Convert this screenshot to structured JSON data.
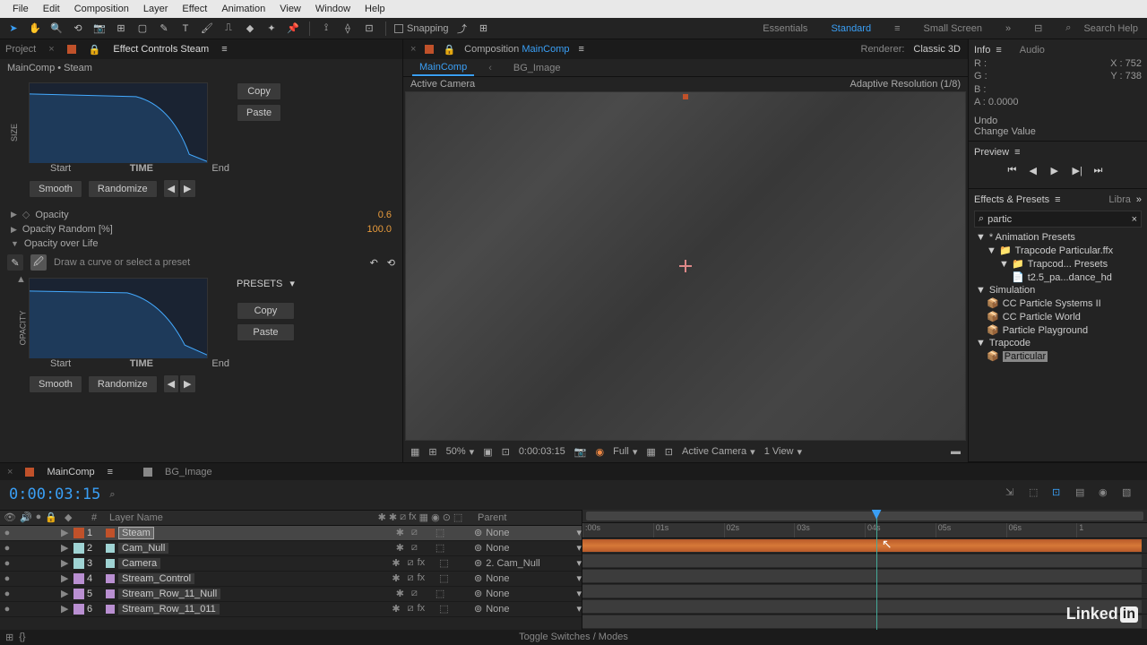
{
  "menu": [
    "File",
    "Edit",
    "Composition",
    "Layer",
    "Effect",
    "Animation",
    "View",
    "Window",
    "Help"
  ],
  "toolbar": {
    "snapping": "Snapping",
    "workspaces": [
      "Essentials",
      "Standard",
      "Small Screen"
    ],
    "active_workspace": "Standard",
    "search_placeholder": "Search Help"
  },
  "left": {
    "tabs": {
      "project": "Project",
      "fx": "Effect Controls",
      "fx_target": "Steam"
    },
    "breadcrumb": "MainComp • Steam",
    "graph1": {
      "ylabel": "SIZE",
      "start": "Start",
      "time": "TIME",
      "end": "End"
    },
    "smooth": "Smooth",
    "randomize": "Randomize",
    "copy": "Copy",
    "paste": "Paste",
    "opacity": {
      "label": "Opacity",
      "value": "0.6"
    },
    "opacity_rand": {
      "label": "Opacity Random [%]",
      "value": "100.0"
    },
    "opacity_life": "Opacity over Life",
    "curve_hint": "Draw a curve or select a preset",
    "presets": "PRESETS",
    "graph2": {
      "ylabel": "OPACITY",
      "start": "Start",
      "time": "TIME",
      "end": "End"
    }
  },
  "center": {
    "tabs": {
      "composition": "Composition",
      "comp_name": "MainComp"
    },
    "subtabs": [
      "MainComp",
      "BG_Image"
    ],
    "renderer_label": "Renderer:",
    "renderer": "Classic 3D",
    "camera": "Active Camera",
    "resolution": "Adaptive Resolution (1/8)",
    "footer": {
      "zoom": "50%",
      "timecode": "0:00:03:15",
      "quality": "Full",
      "view": "Active Camera",
      "views": "1 View"
    }
  },
  "right": {
    "info": "Info",
    "audio": "Audio",
    "rgb": {
      "r": "R :",
      "g": "G :",
      "b": "B :",
      "a": "A :  0.0000"
    },
    "xy": {
      "x": "X : 752",
      "y": "Y : 738"
    },
    "undo": "Undo",
    "change": "Change Value",
    "preview": "Preview",
    "ep": "Effects & Presets",
    "libr": "Libra",
    "search_val": "partic",
    "tree": {
      "anim": "* Animation Presets",
      "trap_ffx": "Trapcode Particular.ffx",
      "trap_pre": "Trapcod... Presets",
      "preset1": "t2.5_pa...dance_hd",
      "sim": "Simulation",
      "cc_sys": "CC Particle Systems II",
      "cc_world": "CC Particle World",
      "pp": "Particle Playground",
      "trap": "Trapcode",
      "particular": "Particular"
    }
  },
  "timeline": {
    "tabs": [
      "MainComp",
      "BG_Image"
    ],
    "timecode": "0:00:03:15",
    "cols": {
      "num": "#",
      "layer": "Layer Name",
      "parent": "Parent"
    },
    "ticks": [
      ":00s",
      "01s",
      "02s",
      "03s",
      "04s",
      "05s",
      "06s",
      "1"
    ],
    "layers": [
      {
        "num": "1",
        "color": "#c0512a",
        "name": "Steam",
        "parent": "None",
        "sel": true
      },
      {
        "num": "2",
        "color": "#9fd3d3",
        "name": "Cam_Null",
        "parent": "None",
        "sel": false
      },
      {
        "num": "3",
        "color": "#9fd3d3",
        "name": "Camera",
        "parent": "2. Cam_Null",
        "sel": false
      },
      {
        "num": "4",
        "color": "#b98fd1",
        "name": "Stream_Control",
        "parent": "None",
        "sel": false
      },
      {
        "num": "5",
        "color": "#b98fd1",
        "name": "Stream_Row_11_Null",
        "parent": "None",
        "sel": false
      },
      {
        "num": "6",
        "color": "#b98fd1",
        "name": "Stream_Row_11_011",
        "parent": "None",
        "sel": false
      }
    ],
    "footer": "Toggle Switches / Modes"
  }
}
